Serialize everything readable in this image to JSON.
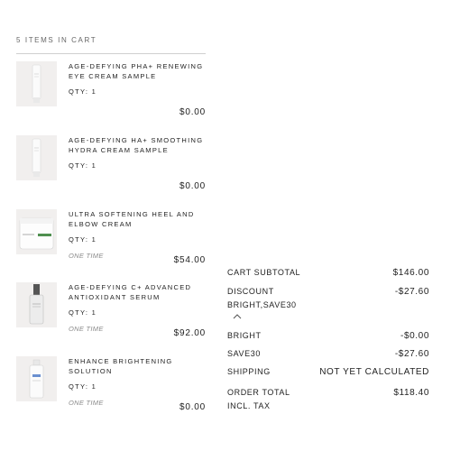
{
  "cart": {
    "header": "5 ITEMS IN CART",
    "items": [
      {
        "name": "AGE-DEFYING PHA+ RENEWING EYE CREAM SAMPLE",
        "qty": "QTY: 1",
        "frequency": "",
        "price": "$0.00"
      },
      {
        "name": "AGE-DEFYING HA+ SMOOTHING HYDRA CREAM SAMPLE",
        "qty": "QTY: 1",
        "frequency": "",
        "price": "$0.00"
      },
      {
        "name": "ULTRA SOFTENING HEEL AND ELBOW CREAM",
        "qty": "QTY: 1",
        "frequency": "ONE TIME",
        "price": "$54.00"
      },
      {
        "name": "AGE-DEFYING C+ ADVANCED ANTIOXIDANT SERUM",
        "qty": "QTY: 1",
        "frequency": "ONE TIME",
        "price": "$92.00"
      },
      {
        "name": "ENHANCE BRIGHTENING SOLUTION",
        "qty": "QTY: 1",
        "frequency": "ONE TIME",
        "price": "$0.00"
      }
    ]
  },
  "summary": {
    "subtotal_label": "CART SUBTOTAL",
    "subtotal_value": "$146.00",
    "discount_label": "DISCOUNT",
    "discount_codes": "BRIGHT,SAVE30",
    "discount_value": "-$27.60",
    "codes": [
      {
        "label": "BRIGHT",
        "value": "-$0.00"
      },
      {
        "label": "SAVE30",
        "value": "-$27.60"
      }
    ],
    "shipping_label": "SHIPPING",
    "shipping_value": "NOT YET CALCULATED",
    "total_label": "ORDER TOTAL",
    "total_sublabel": "INCL. TAX",
    "total_value": "$118.40"
  },
  "icons": {
    "toggle": "chevron-up-icon"
  }
}
